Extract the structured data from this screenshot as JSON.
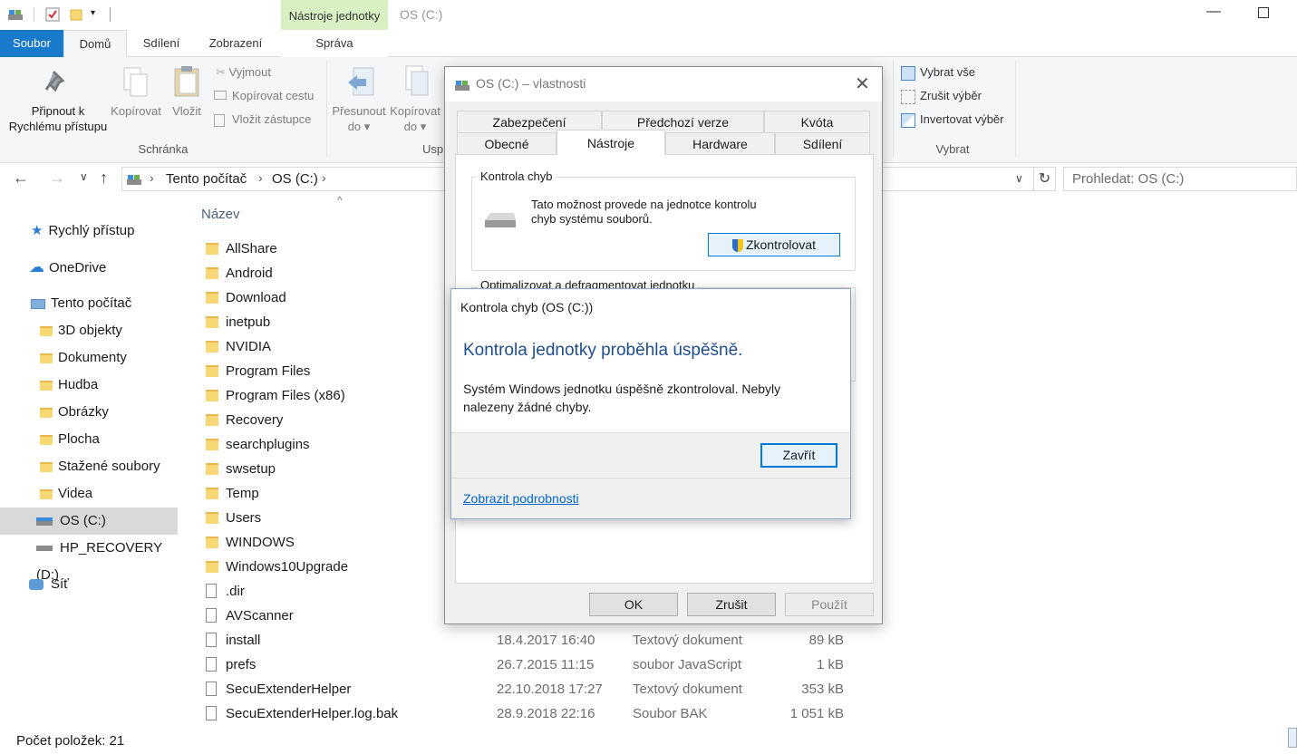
{
  "window": {
    "ribbon_context_tab": "Nástroje jednotky",
    "title": "OS (C:)"
  },
  "ribbon_tabs": {
    "file": "Soubor",
    "home": "Domů",
    "share": "Sdílení",
    "view": "Zobrazení",
    "manage": "Správa"
  },
  "ribbon": {
    "pin_label_1": "Připnout k",
    "pin_label_2": "Rychlému přístupu",
    "copy": "Kopírovat",
    "paste": "Vložit",
    "cut": "Vyjmout",
    "copy_path": "Kopírovat cestu",
    "paste_shortcut": "Vložit zástupce",
    "clipboard_group": "Schránka",
    "move_to_1": "Přesunout",
    "move_to_2": "do",
    "copy_to_1": "Kopírovat",
    "copy_to_2": "do",
    "organize_group_partial": "Usp",
    "select_all": "Vybrat vše",
    "select_none": "Zrušit výběr",
    "invert_selection": "Invertovat výběr",
    "select_group": "Vybrat"
  },
  "address": {
    "crumb_1": "Tento počítač",
    "crumb_2": "OS (C:)",
    "search_placeholder": "Prohledat: OS (C:)"
  },
  "nav": {
    "quick_access": "Rychlý přístup",
    "onedrive": "OneDrive",
    "this_pc": "Tento počítač",
    "objects3d": "3D objekty",
    "documents": "Dokumenty",
    "music": "Hudba",
    "pictures": "Obrázky",
    "desktop": "Plocha",
    "downloads": "Stažené soubory",
    "videos": "Videa",
    "os_c": "OS (C:)",
    "recovery_d": "HP_RECOVERY (D:)",
    "network": "Síť"
  },
  "list": {
    "col_name": "Název",
    "folders": [
      "AllShare",
      "Android",
      "Download",
      "inetpub",
      "NVIDIA",
      "Program Files",
      "Program Files (x86)",
      "Recovery",
      "searchplugins",
      "swsetup",
      "Temp",
      "Users",
      "WINDOWS",
      "Windows10Upgrade"
    ],
    "files": [
      {
        "name": ".dir",
        "date": "",
        "type": "",
        "size": ""
      },
      {
        "name": "AVScanner",
        "date": "",
        "type": "",
        "size": ""
      },
      {
        "name": "install",
        "date": "18.4.2017 16:40",
        "type": "Textový dokument",
        "size": "89 kB"
      },
      {
        "name": "prefs",
        "date": "26.7.2015 11:15",
        "type": "soubor JavaScript",
        "size": "1 kB"
      },
      {
        "name": "SecuExtenderHelper",
        "date": "22.10.2018 17:27",
        "type": "Textový dokument",
        "size": "353 kB"
      },
      {
        "name": "SecuExtenderHelper.log.bak",
        "date": "28.9.2018 22:16",
        "type": "Soubor BAK",
        "size": "1 051 kB"
      }
    ]
  },
  "status": {
    "count": "Počet položek: 21"
  },
  "properties_dialog": {
    "title": "OS (C:) – vlastnosti",
    "tabs_back": [
      "Zabezpečení",
      "Předchozí verze",
      "Kvóta"
    ],
    "tabs_front": [
      "Obecné",
      "Nástroje",
      "Hardware",
      "Sdílení"
    ],
    "error_group": "Kontrola chyb",
    "error_desc_1": "Tato možnost provede na jednotce kontrolu",
    "error_desc_2": "chyb systému souborů.",
    "check_button": "Zkontrolovat",
    "optimize_group": "Optimalizovat a defragmentovat jednotku",
    "ok": "OK",
    "cancel": "Zrušit",
    "apply": "Použít"
  },
  "check_dialog": {
    "title": "Kontrola chyb (OS (C:))",
    "heading": "Kontrola jednotky proběhla úspěšně.",
    "body_1": "Systém Windows jednotku úspěšně zkontroloval. Nebyly",
    "body_2": "nalezeny žádné chyby.",
    "close": "Zavřít",
    "details_link": "Zobrazit podrobnosti"
  },
  "colors": {
    "accent": "#1979ca",
    "context_tab": "#d9f0c2",
    "link": "#0066cc",
    "heading_blue": "#1f4e8c"
  }
}
